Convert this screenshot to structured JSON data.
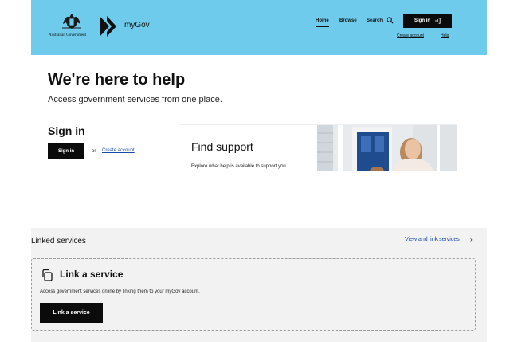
{
  "header": {
    "gov_name": "Australian Government",
    "brand": "myGov",
    "nav": {
      "home": "Home",
      "browse": "Browse",
      "search": "Search"
    },
    "sign_in": "Sign in",
    "create_account": "Create account",
    "help": "Help"
  },
  "hero": {
    "title": "We're here to help",
    "subtitle": "Access government services from one place."
  },
  "signin": {
    "heading": "Sign in",
    "button": "Sign in",
    "or": "or",
    "create_account": "Create account"
  },
  "support": {
    "title": "Find support",
    "description": "Explore what help is available to support you"
  },
  "linked": {
    "title": "Linked services",
    "view_link": "View and link services",
    "card": {
      "title": "Link a service",
      "description": "Access government services online by linking them to your myGov account.",
      "button": "Link a service"
    }
  },
  "colors": {
    "header_bg": "#6ecbeb",
    "button_bg": "#0b0b0b",
    "link": "#1a4ba8",
    "section_bg": "#f2f2f2"
  },
  "icons": {
    "search": "search-icon",
    "sign_in": "sign-in-arrow-icon",
    "link_service": "copy-link-icon",
    "chevron": "chevron-right-icon"
  }
}
